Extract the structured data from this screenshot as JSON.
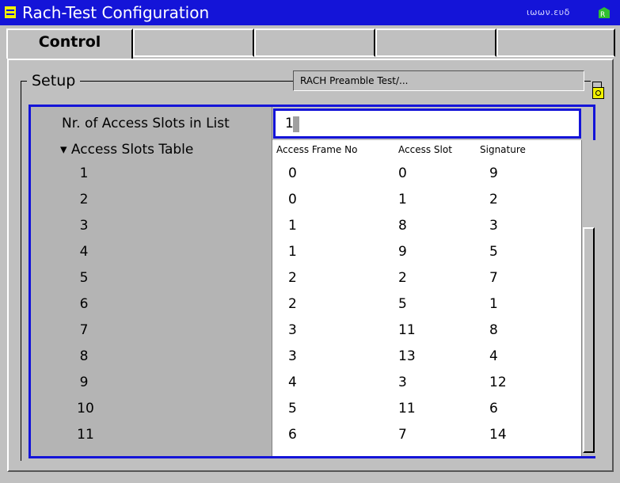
{
  "window": {
    "title": "Rach-Test Configuration",
    "status_text": "ιωων.ευδ"
  },
  "tabs": [
    {
      "label": "Control",
      "active": true
    },
    {
      "label": "",
      "active": false
    },
    {
      "label": "",
      "active": false
    },
    {
      "label": "",
      "active": false
    },
    {
      "label": "",
      "active": false
    }
  ],
  "setup": {
    "legend": "Setup",
    "preamble_field": "RACH Preamble Test/..."
  },
  "params": {
    "nr_access_slots_label": "Nr. of Access Slots in List",
    "nr_access_slots_value": "1",
    "access_slots_table_label": "▾ Access Slots Table"
  },
  "table": {
    "columns": [
      "Access Frame No",
      "Access Slot",
      "Signature"
    ],
    "rows": [
      {
        "index": "1",
        "frame": "0",
        "slot": "0",
        "signature": "9"
      },
      {
        "index": "2",
        "frame": "0",
        "slot": "1",
        "signature": "2"
      },
      {
        "index": "3",
        "frame": "1",
        "slot": "8",
        "signature": "3"
      },
      {
        "index": "4",
        "frame": "1",
        "slot": "9",
        "signature": "5"
      },
      {
        "index": "5",
        "frame": "2",
        "slot": "2",
        "signature": "7"
      },
      {
        "index": "6",
        "frame": "2",
        "slot": "5",
        "signature": "1"
      },
      {
        "index": "7",
        "frame": "3",
        "slot": "11",
        "signature": "8"
      },
      {
        "index": "8",
        "frame": "3",
        "slot": "13",
        "signature": "4"
      },
      {
        "index": "9",
        "frame": "4",
        "slot": "3",
        "signature": "12"
      },
      {
        "index": "10",
        "frame": "5",
        "slot": "11",
        "signature": "6"
      },
      {
        "index": "11",
        "frame": "6",
        "slot": "7",
        "signature": "14"
      }
    ]
  },
  "colors": {
    "title_bar": "#1414d8",
    "accent_yellow": "#f0f000",
    "panel_gray": "#c0c0c0"
  }
}
